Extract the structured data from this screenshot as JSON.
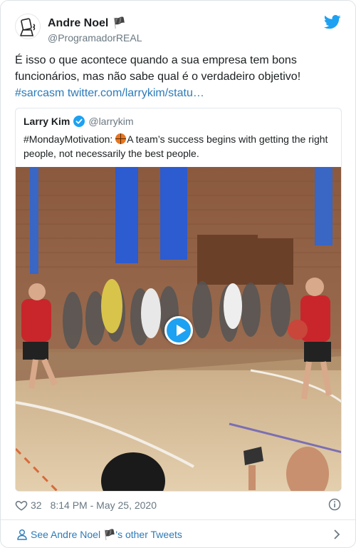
{
  "author": {
    "name": "Andre Noel",
    "flag": "🏴",
    "handle": "@ProgramadorREAL"
  },
  "tweet": {
    "text": "É isso o que acontece quando a sua empresa tem bons funcionários, mas não sabe qual é o verdadeiro objetivo!",
    "hashtag": "#sarcasm",
    "link": "twitter.com/larrykim/statu…"
  },
  "quoted": {
    "name": "Larry Kim",
    "handle": "@larrykim",
    "hashtag": "#MondayMotivation:",
    "text": "A team’s success begins with getting the right people, not necessarily the best people."
  },
  "meta": {
    "likes": "32",
    "timestamp": "8:14 PM - May 25, 2020"
  },
  "footer": {
    "prefix": "See Andre Noel",
    "flag": "🏴",
    "suffix": "'s other Tweets"
  },
  "icons": [
    "twitter-bird-icon",
    "verified-badge-icon",
    "basketball-emoji-icon",
    "play-icon",
    "heart-icon",
    "info-icon",
    "person-icon",
    "chevron-right-icon"
  ],
  "colors": {
    "link": "#2b7bb9",
    "twitter_blue": "#1da1f2",
    "muted": "#697882"
  }
}
